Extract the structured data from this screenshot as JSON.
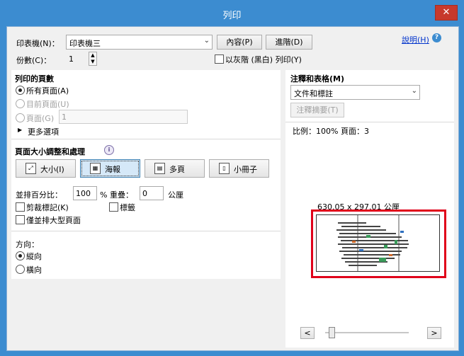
{
  "window": {
    "title": "列印",
    "close_label": "✕"
  },
  "printer": {
    "label": "印表機(N)：",
    "selected": "印表機三",
    "properties_button": "內容(P)",
    "advanced_button": "進階(D)",
    "help_link": "說明(H)",
    "help_icon": "?"
  },
  "copies": {
    "label": "份數(C)：",
    "value": "1",
    "grayscale_label": "以灰階 (黑白) 列印(Y)"
  },
  "pages_to_print": {
    "title": "列印的頁數",
    "all_pages": "所有頁面(A)",
    "current_page": "目前頁面(U)",
    "pages": "頁面(G)",
    "pages_value": "1",
    "more_options": "更多選項"
  },
  "page_sizing": {
    "title": "頁面大小調整和處理",
    "info_icon": "i",
    "buttons": [
      {
        "label": "大小(I)",
        "icon": "size-icon"
      },
      {
        "label": "海報",
        "icon": "poster-icon"
      },
      {
        "label": "多頁",
        "icon": "multiple-icon"
      },
      {
        "label": "小冊子",
        "icon": "booklet-icon"
      }
    ],
    "tile_scale_label": "並排百分比：",
    "tile_scale_value": "100",
    "overlap_label": "% 重疊：",
    "overlap_value": "0",
    "overlap_unit": "公厘",
    "cut_marks": "剪裁標記(K)",
    "labels": "標籤",
    "tile_large_pages": "僅並排大型頁面"
  },
  "orientation": {
    "title": "方向：",
    "portrait": "縱向",
    "landscape": "橫向"
  },
  "comments_forms": {
    "title": "注釋和表格(M)",
    "selected": "文件和標註",
    "summarize_button": "注釋摘要(T)"
  },
  "preview": {
    "scale_text": "比例：100% 頁面：3",
    "dimensions": "630.05 x 297.01 公厘",
    "prev_label": "<",
    "next_label": ">",
    "slider_position": 0.05
  },
  "colors": {
    "titlebar": "#3c8cd0",
    "highlight": "#e0001a",
    "link": "#0033cc"
  }
}
